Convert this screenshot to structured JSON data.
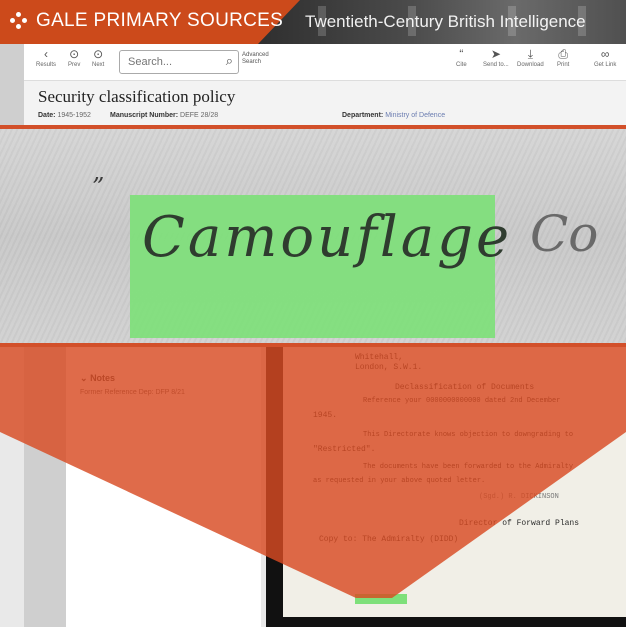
{
  "banner": {
    "brand": "GALE PRIMARY SOURCES",
    "collection": "Twentieth-Century British Intelligence"
  },
  "toolbar": {
    "results_label": "Results",
    "prev_label": "Prev",
    "next_label": "Next",
    "search_placeholder": "Search...",
    "advanced_search_line1": "Advanced",
    "advanced_search_line2": "Search",
    "cite_label": "Cite",
    "send_label": "Send to...",
    "download_label": "Download",
    "print_label": "Print",
    "getlink_label": "Get Link"
  },
  "document": {
    "title": "Security classification policy",
    "date_label": "Date:",
    "date_value": "1945-1952",
    "manuscript_label": "Manuscript Number:",
    "manuscript_value": "DEFE 28/28",
    "department_label": "Department:",
    "department_value": "Ministry of Defence"
  },
  "zoom": {
    "highlighted_word": "Camouflage",
    "adjacent_word": "Co"
  },
  "notes": {
    "title": "Notes",
    "reference": "Former Reference Dep: DFP 8/21"
  },
  "scan_lines": [
    "Whitehall,",
    "London, S.W.1.",
    "Declassification of Documents",
    "Reference your 0000000000000 dated 2nd December",
    "1945.",
    "This Directorate knows objection to downgrading to",
    "\"Restricted\".",
    "The documents have been forwarded to the Admiralty",
    "as requested in your above quoted letter.",
    "(Sgd.) R. DICKINSON",
    "Director of Forward Plans",
    "Copy to:  The Admiralty (DIDD)"
  ],
  "colors": {
    "accent": "#cc4a1b",
    "highlight": "#7ee07a"
  }
}
